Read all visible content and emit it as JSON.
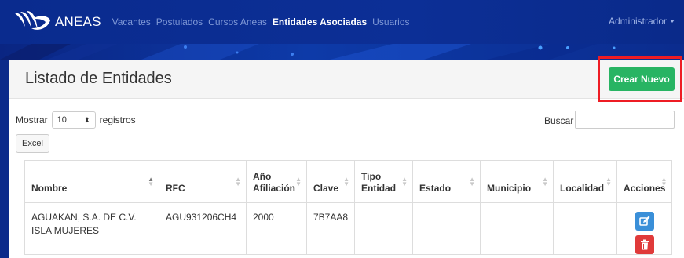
{
  "nav": {
    "brand": "ANEAS",
    "items": [
      {
        "label": "Vacantes",
        "active": false
      },
      {
        "label": "Postulados",
        "active": false
      },
      {
        "label": "Cursos Aneas",
        "active": false
      },
      {
        "label": "Entidades Asociadas",
        "active": true
      },
      {
        "label": "Usuarios",
        "active": false
      }
    ],
    "user": "Administrador"
  },
  "page": {
    "title": "Listado de Entidades",
    "new_button": "Crear Nuevo"
  },
  "controls": {
    "show_label": "Mostrar",
    "page_size": "10",
    "records_label": "registros",
    "search_label": "Buscar",
    "search_value": "",
    "excel_button": "Excel"
  },
  "table": {
    "columns": [
      "Nombre",
      "RFC",
      "Año Afiliación",
      "Clave",
      "Tipo Entidad",
      "Estado",
      "Municipio",
      "Localidad",
      "Acciones"
    ],
    "rows": [
      {
        "nombre": "AGUAKAN, S.A. DE C.V. ISLA MUJERES",
        "rfc": "AGU931206CH4",
        "anio": "2000",
        "clave": "7B7AA8",
        "tipo": "",
        "estado": "",
        "municipio": "",
        "localidad": ""
      }
    ]
  },
  "colors": {
    "navbar": "#0a2b8e",
    "accent_green": "#28b463",
    "edit_blue": "#3a8fd8",
    "delete_red": "#e03a3a",
    "highlight_red": "#ee1c24"
  },
  "icons": {
    "logo": "aneas-logo-icon",
    "edit": "edit-icon",
    "delete": "trash-icon"
  }
}
